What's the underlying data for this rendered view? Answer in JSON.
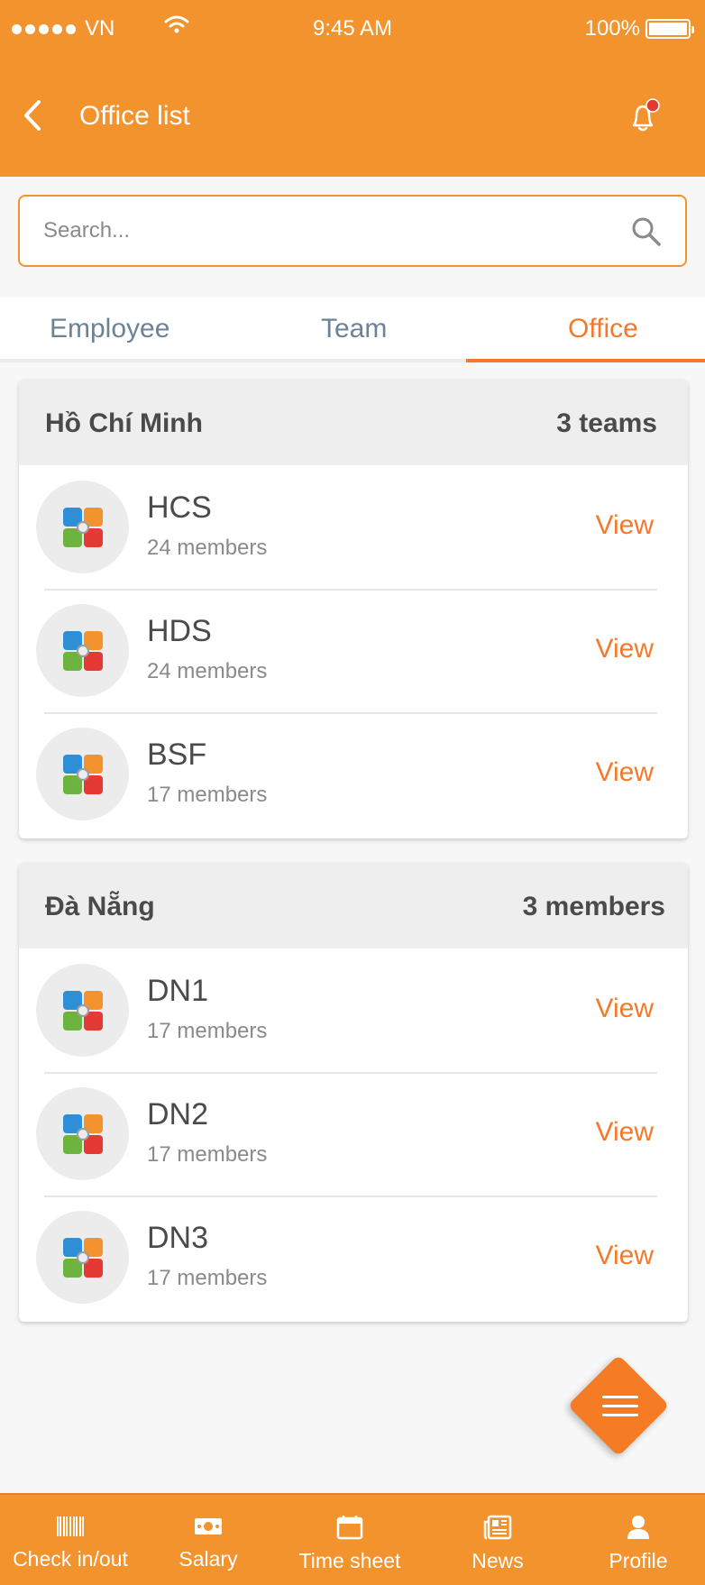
{
  "status_bar": {
    "carrier": "VN",
    "time": "9:45 AM",
    "battery": "100%"
  },
  "header": {
    "title": "Office list"
  },
  "search": {
    "placeholder": "Search..."
  },
  "tabs": [
    {
      "label": "Employee",
      "active": false
    },
    {
      "label": "Team",
      "active": false
    },
    {
      "label": "Office",
      "active": true
    }
  ],
  "offices": [
    {
      "city": "Hồ Chí Minh",
      "count": "3 teams",
      "teams": [
        {
          "name": "HCS",
          "members": "24 members",
          "action": "View"
        },
        {
          "name": "HDS",
          "members": "24 members",
          "action": "View"
        },
        {
          "name": "BSF",
          "members": "17 members",
          "action": "View"
        }
      ]
    },
    {
      "city": "Đà Nẵng",
      "count": "3 members",
      "teams": [
        {
          "name": "DN1",
          "members": "17 members",
          "action": "View"
        },
        {
          "name": "DN2",
          "members": "17 members",
          "action": "View"
        },
        {
          "name": "DN3",
          "members": "17 members",
          "action": "View"
        }
      ]
    }
  ],
  "bottom_nav": [
    {
      "label": "Check in/out",
      "icon": "barcode-icon"
    },
    {
      "label": "Salary",
      "icon": "money-icon"
    },
    {
      "label": "Time sheet",
      "icon": "calendar-icon"
    },
    {
      "label": "News",
      "icon": "newspaper-icon"
    },
    {
      "label": "Profile",
      "icon": "person-icon"
    }
  ],
  "colors": {
    "primary": "#f2932e",
    "accent": "#f5792a",
    "notification_dot": "#e53935"
  }
}
